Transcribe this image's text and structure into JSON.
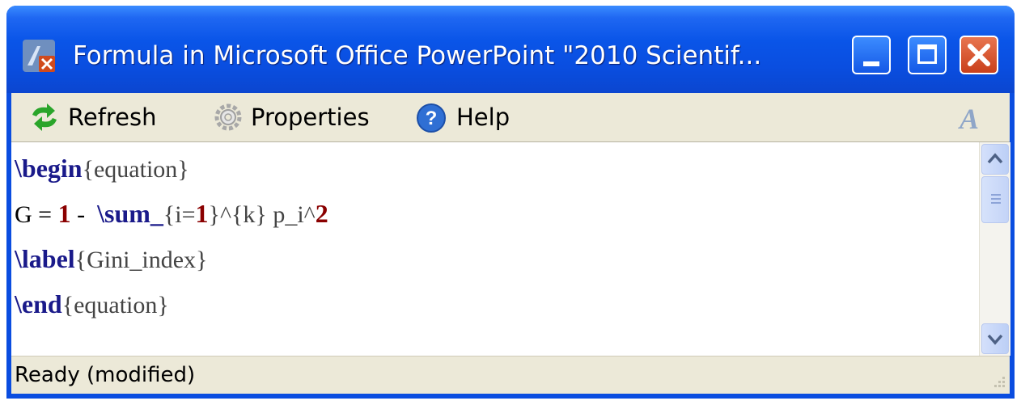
{
  "window": {
    "title": "Formula in Microsoft Office PowerPoint \"2010 Scientif...",
    "buttons": {
      "minimize": "minimize",
      "maximize": "maximize",
      "close": "close"
    }
  },
  "toolbar": {
    "refresh_label": "Refresh",
    "properties_label": "Properties",
    "help_label": "Help",
    "icons": [
      "refresh-icon",
      "gear-icon",
      "help-icon",
      "font-icon"
    ]
  },
  "editor": {
    "lines": [
      {
        "kw1": "\\begin",
        "text1": "{equation}"
      },
      {
        "t1": "G = ",
        "n1": "1",
        "t2": " -  ",
        "kw1": "\\sum_",
        "t3": "{i=",
        "n2": "1",
        "t4": "}^{k} p_i^",
        "n3": "2"
      },
      {
        "kw1": "\\label",
        "text1": "{Gini_index}"
      },
      {
        "kw1": "\\end",
        "text1": "{equation}"
      }
    ]
  },
  "status": {
    "text": "Ready (modified)"
  },
  "colors": {
    "titlebar": "#0a55e8",
    "keyword": "#1a1a8a",
    "number": "#8a0000",
    "close_button": "#d9532f",
    "chrome": "#ece9d8"
  }
}
